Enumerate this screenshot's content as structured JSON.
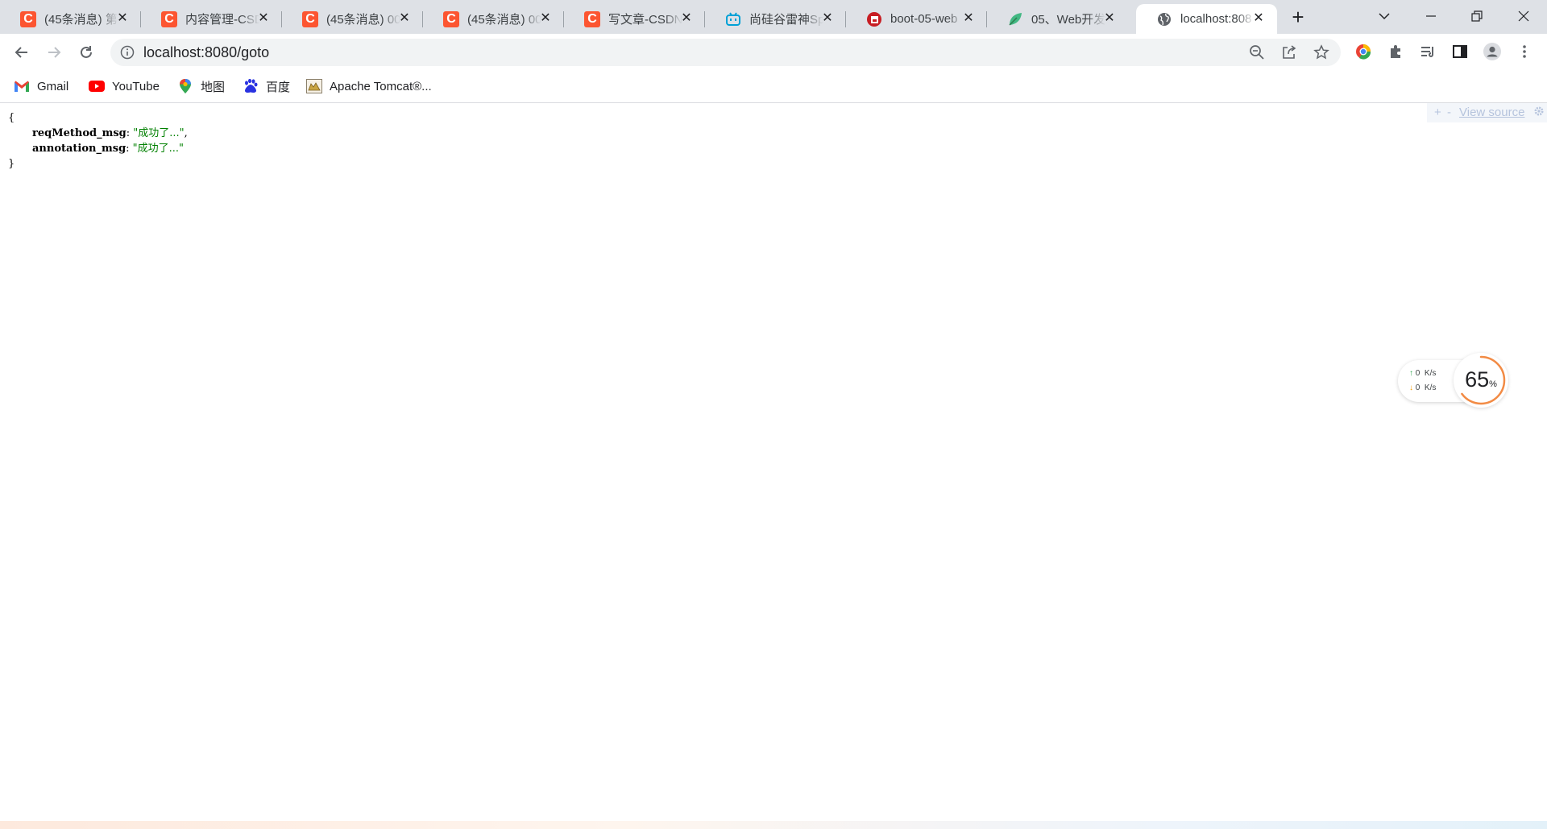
{
  "tabs": [
    {
      "title": "(45条消息) 第",
      "icon": "csdn-icon",
      "close": "✕"
    },
    {
      "title": "内容管理-CSD",
      "icon": "csdn-icon",
      "close": "✕"
    },
    {
      "title": "(45条消息) 00",
      "icon": "csdn-icon",
      "close": "✕"
    },
    {
      "title": "(45条消息) 00",
      "icon": "csdn-icon",
      "close": "✕"
    },
    {
      "title": "写文章-CSDN",
      "icon": "csdn-icon",
      "close": "✕"
    },
    {
      "title": "尚硅谷雷神Sp",
      "icon": "bilibili-icon",
      "close": "✕"
    },
    {
      "title": "boot-05-web",
      "icon": "gitee-icon",
      "close": "✕"
    },
    {
      "title": "05、Web开发",
      "icon": "leaf-icon",
      "close": "✕"
    },
    {
      "title": "localhost:808",
      "icon": "globe-icon",
      "close": "✕",
      "active": true
    }
  ],
  "address_bar": {
    "url": "localhost:8080/goto"
  },
  "bookmarks": [
    {
      "label": "Gmail",
      "icon": "gmail-icon"
    },
    {
      "label": "YouTube",
      "icon": "youtube-icon"
    },
    {
      "label": "地图",
      "icon": "maps-icon"
    },
    {
      "label": "百度",
      "icon": "baidu-icon"
    },
    {
      "label": "Apache Tomcat®...",
      "icon": "tomcat-icon"
    }
  ],
  "json_view": {
    "open_brace": "{",
    "close_brace": "}",
    "entries": [
      {
        "key": "reqMethod_msg",
        "value": "\"成功了...\"",
        "trailing": ","
      },
      {
        "key": "annotation_msg",
        "value": "\"成功了...\"",
        "trailing": ""
      }
    ],
    "colon": ": "
  },
  "viewer_toolbar": {
    "plus": "+",
    "minus": "-",
    "view_source": "View source"
  },
  "speed_widget": {
    "upload": {
      "value": "0",
      "unit": "K/s"
    },
    "download": {
      "value": "0",
      "unit": "K/s"
    },
    "percent": "65",
    "percent_unit": "%",
    "percent_fraction": 0.65
  },
  "colors": {
    "csdn": "#fc5531",
    "json_string": "#008000",
    "gauge": "#f28b45"
  }
}
